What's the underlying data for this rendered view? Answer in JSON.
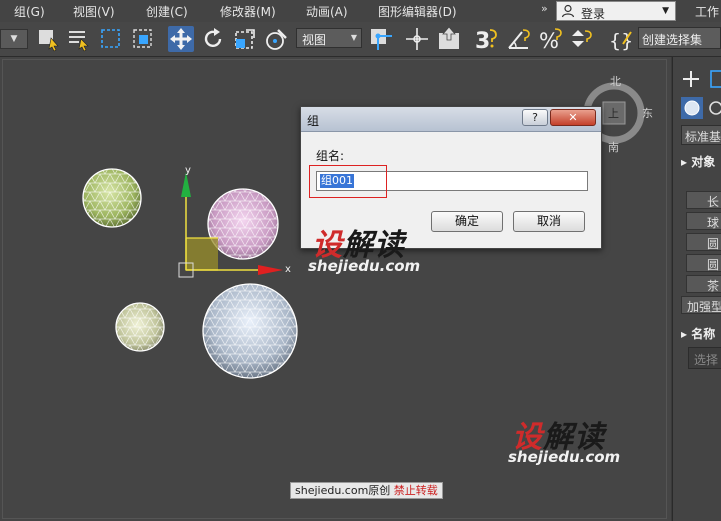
{
  "menubar": {
    "items": [
      "组(G)",
      "视图(V)",
      "创建(C)",
      "修改器(M)",
      "动画(A)",
      "图形编辑器(D)"
    ],
    "login_label": "登录",
    "workspace_label": "工作"
  },
  "toolbar": {
    "view_dropdown": "视图",
    "selection_set": "创建选择集"
  },
  "viewport": {
    "axis_y": "y",
    "axis_x": "x",
    "compass": {
      "north": "北",
      "east": "东",
      "south": "南",
      "top": "上"
    }
  },
  "dialog": {
    "title": "组",
    "help_label": "?",
    "close_label": "✕",
    "field_label": "组名:",
    "field_value": "组001",
    "ok_label": "确定",
    "cancel_label": "取消"
  },
  "command_panel": {
    "category": "标准基",
    "rollout_object": "▸ 对象",
    "buttons": [
      "长",
      "球",
      "圆",
      "圆",
      "茶",
      "加强型"
    ],
    "rollout_name": "▸ 名称",
    "name_placeholder": "选择"
  },
  "watermark": {
    "cn_red": "设",
    "cn_black": "解读",
    "url": "shejiedu.com",
    "footer_text": "shejiedu.com原创",
    "footer_warning": "禁止转载"
  },
  "colors": {
    "accent": "#3e6aa8",
    "close_button": "#c4402a",
    "selection": "#3875d7",
    "watermark_red": "#cf2b2b"
  }
}
